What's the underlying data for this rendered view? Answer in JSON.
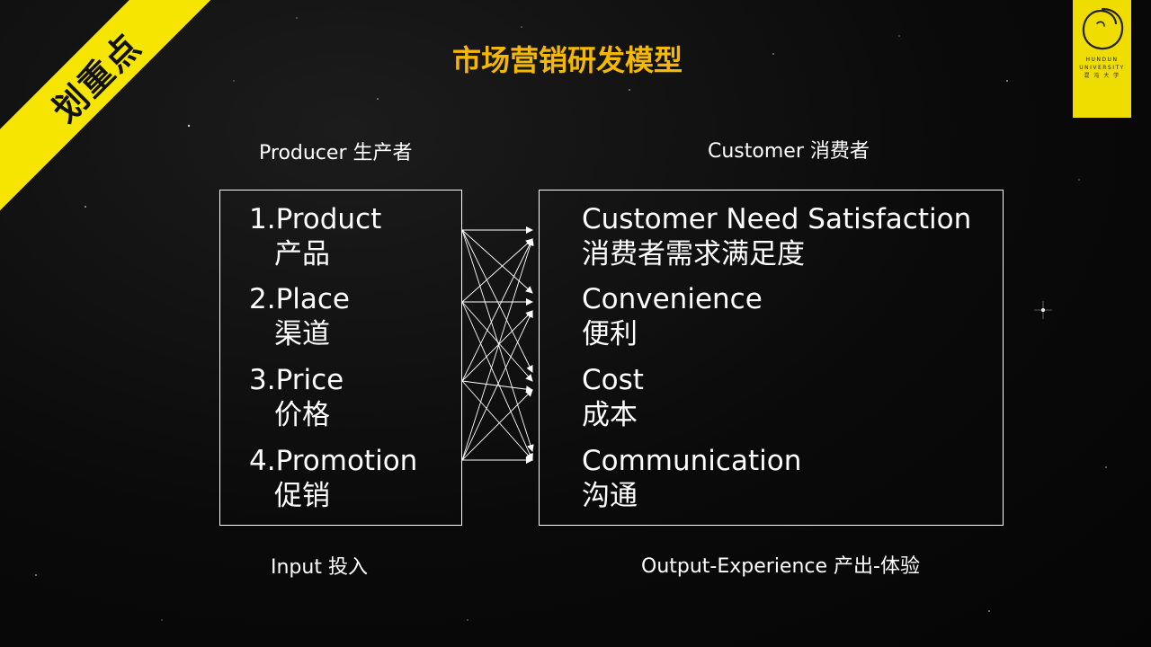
{
  "ribbon": {
    "text": "划重点"
  },
  "logo": {
    "line1": "HUNDUN",
    "line2": "UNIVERSITY",
    "line3": "混 沌 大 学"
  },
  "title": "市场营销研发模型",
  "left": {
    "header": "Producer 生产者",
    "footer": "Input  投入",
    "items": [
      {
        "en": "1.Product",
        "cn": "产品"
      },
      {
        "en": "2.Place",
        "cn": "渠道"
      },
      {
        "en": "3.Price",
        "cn": "价格"
      },
      {
        "en": "4.Promotion",
        "cn": "促销"
      }
    ]
  },
  "right": {
    "header": "Customer  消费者",
    "footer": "Output-Experience  产出-体验",
    "items": [
      {
        "en": "Customer Need Satisfaction",
        "cn": "消费者需求满足度"
      },
      {
        "en": "Convenience",
        "cn": "便利"
      },
      {
        "en": "Cost",
        "cn": "成本"
      },
      {
        "en": "Communication",
        "cn": "沟通"
      }
    ]
  },
  "colors": {
    "title": "#f5b800",
    "ribbon": "#f5e500",
    "logo_bg": "#f0dd00",
    "background": "#0a0a0a",
    "text": "#ffffff"
  }
}
